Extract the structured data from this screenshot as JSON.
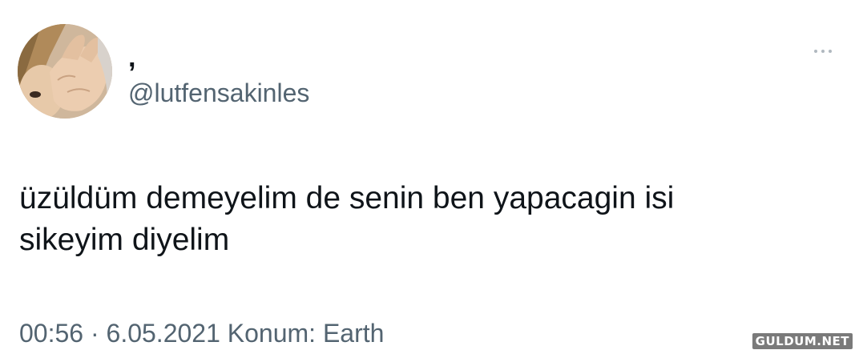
{
  "tweet": {
    "display_name": ",",
    "handle": "@lutfensakinles",
    "text": "üzüldüm demeyelim de senin ben yapacagin isi\nsikeyim diyelim",
    "time": "00:56",
    "separator": "·",
    "date": "6.05.2021",
    "location_label": "Konum: Earth",
    "more_icon": "more-horizontal-icon"
  },
  "watermark": "GULDUM.NET"
}
